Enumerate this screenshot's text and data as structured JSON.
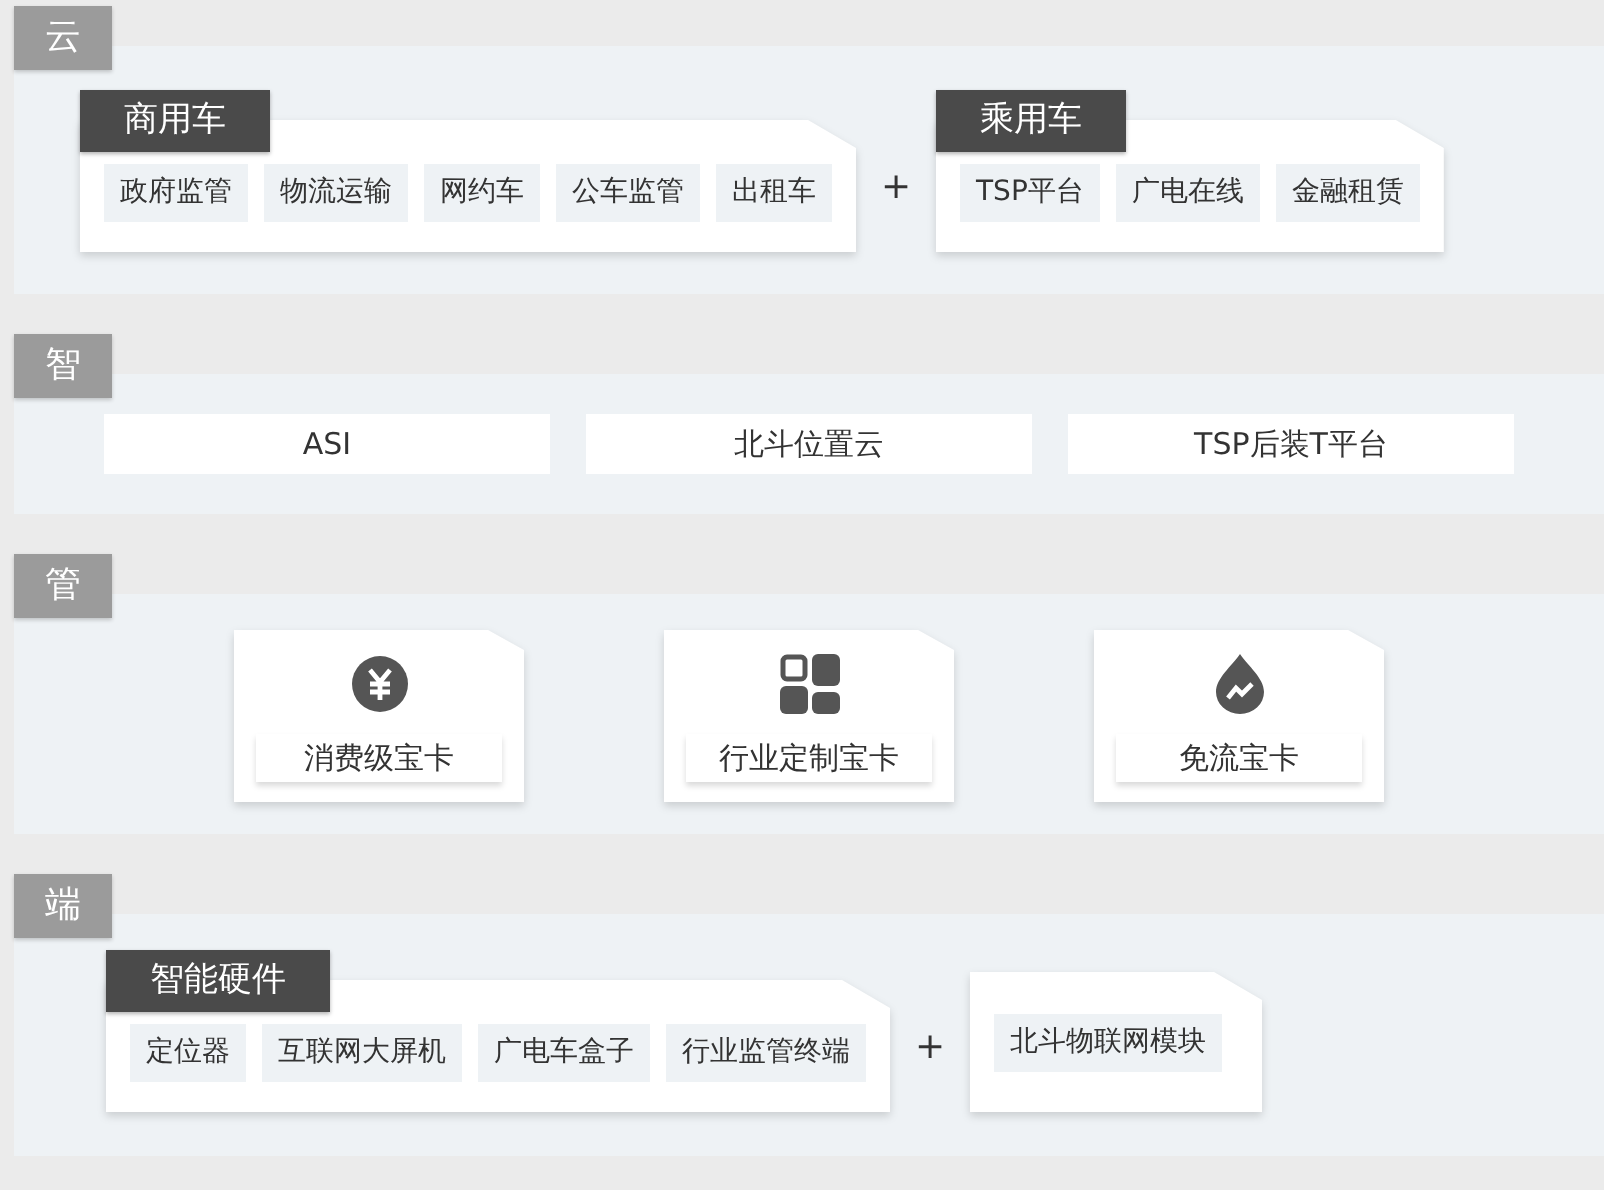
{
  "sections": [
    {
      "label": "云",
      "kind": "groups",
      "joiner": "+",
      "groups": [
        {
          "title": "商用车",
          "items": [
            "政府监管",
            "物流运输",
            "网约车",
            "公车监管",
            "出租车"
          ]
        },
        {
          "title": "乘用车",
          "items": [
            "TSP平台",
            "广电在线",
            "金融租赁"
          ]
        }
      ]
    },
    {
      "label": "智",
      "kind": "bars",
      "items": [
        "ASI",
        "北斗位置云",
        "TSP后装T平台"
      ]
    },
    {
      "label": "管",
      "kind": "cards",
      "cards": [
        {
          "label": "消费级宝卡"
        },
        {
          "label": "行业定制宝卡"
        },
        {
          "label": "免流宝卡"
        }
      ]
    },
    {
      "label": "端",
      "kind": "groups",
      "joiner": "+",
      "groups": [
        {
          "title": "智能硬件",
          "items": [
            "定位器",
            "互联网大屏机",
            "广电车盒子",
            "行业监管终端"
          ]
        },
        {
          "items": [
            "北斗物联网模块"
          ]
        }
      ]
    }
  ]
}
